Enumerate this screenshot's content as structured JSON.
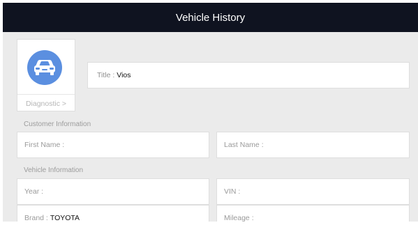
{
  "header": {
    "title": "Vehicle History"
  },
  "vehicle_card": {
    "icon": "car-icon",
    "diagnostic_label": "Diagnostic >"
  },
  "title_field": {
    "label": "Title :",
    "value": "Vios"
  },
  "customer_section": {
    "heading": "Customer Information",
    "first_name_label": "First Name :",
    "last_name_label": "Last Name :"
  },
  "vehicle_section": {
    "heading": "Vehicle Information",
    "year_label": "Year :",
    "vin_label": "VIN :",
    "brand_label": "Brand :",
    "brand_value": "TOYOTA",
    "mileage_label": "Mileage :"
  },
  "colors": {
    "header_bg": "#0f1320",
    "icon_circle": "#5b8fe0",
    "content_bg": "#ebebeb"
  }
}
